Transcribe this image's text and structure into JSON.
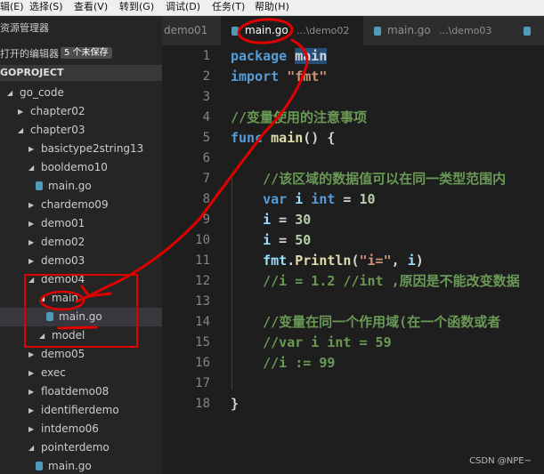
{
  "menubar": {
    "items": [
      "辑(E)",
      "选择(S)",
      "查看(V)",
      "转到(G)",
      "调试(D)",
      "任务(T)",
      "帮助(H)"
    ]
  },
  "sidebar": {
    "title": "资源管理器",
    "open_editors_label": "打开的编辑器",
    "unsaved_badge": "5 个未保存",
    "project": "GOPROJECT",
    "tree": [
      {
        "label": "go_code",
        "kind": "folder",
        "expanded": true
      },
      {
        "label": "chapter02",
        "kind": "folder",
        "expanded": false
      },
      {
        "label": "chapter03",
        "kind": "folder",
        "expanded": true
      },
      {
        "label": "basictype2string13",
        "kind": "folder",
        "expanded": false
      },
      {
        "label": "booldemo10",
        "kind": "folder",
        "expanded": true
      },
      {
        "label": "main.go",
        "kind": "file"
      },
      {
        "label": "chardemo09",
        "kind": "folder",
        "expanded": false
      },
      {
        "label": "demo01",
        "kind": "folder",
        "expanded": false
      },
      {
        "label": "demo02",
        "kind": "folder",
        "expanded": false
      },
      {
        "label": "demo03",
        "kind": "folder",
        "expanded": false
      },
      {
        "label": "demo04",
        "kind": "folder",
        "expanded": true
      },
      {
        "label": "main",
        "kind": "folder",
        "expanded": true
      },
      {
        "label": "main.go",
        "kind": "file",
        "selected": true
      },
      {
        "label": "model",
        "kind": "folder",
        "expanded": true
      },
      {
        "label": "demo05",
        "kind": "folder",
        "expanded": false
      },
      {
        "label": "exec",
        "kind": "folder",
        "expanded": false
      },
      {
        "label": "floatdemo08",
        "kind": "folder",
        "expanded": false
      },
      {
        "label": "identifierdemo",
        "kind": "folder",
        "expanded": false
      },
      {
        "label": "intdemo06",
        "kind": "folder",
        "expanded": false
      },
      {
        "label": "pointerdemo",
        "kind": "folder",
        "expanded": true
      },
      {
        "label": "main.go",
        "kind": "file"
      }
    ]
  },
  "tabs": [
    {
      "name": "demo01",
      "path": "",
      "active": false
    },
    {
      "name": "main.go",
      "path": "...\\demo02",
      "active": true
    },
    {
      "name": "main.go",
      "path": "...\\demo03",
      "active": false
    },
    {
      "name": "",
      "path": "",
      "active": false
    }
  ],
  "editor": {
    "line_numbers": [
      "1",
      "2",
      "3",
      "4",
      "5",
      "6",
      "7",
      "8",
      "9",
      "10",
      "11",
      "12",
      "13",
      "14",
      "15",
      "16",
      "17",
      "18"
    ],
    "lines": [
      [
        [
          "kw",
          "package"
        ],
        [
          "plain",
          " "
        ],
        [
          "hl",
          "main"
        ]
      ],
      [
        [
          "kw",
          "import"
        ],
        [
          "plain",
          " "
        ],
        [
          "str",
          "\"fmt\""
        ]
      ],
      [],
      [
        [
          "cm",
          "//变量使用的注意事项"
        ]
      ],
      [
        [
          "kw",
          "func"
        ],
        [
          "plain",
          " "
        ],
        [
          "fn",
          "main"
        ],
        [
          "plain",
          "() {"
        ]
      ],
      [],
      [
        [
          "cm",
          "    //该区域的数据值可以在同一类型范围内"
        ]
      ],
      [
        [
          "plain",
          "    "
        ],
        [
          "kw",
          "var"
        ],
        [
          "plain",
          " "
        ],
        [
          "var",
          "i"
        ],
        [
          "plain",
          " "
        ],
        [
          "kw",
          "int"
        ],
        [
          "plain",
          " = "
        ],
        [
          "num",
          "10"
        ]
      ],
      [
        [
          "plain",
          "    "
        ],
        [
          "var",
          "i"
        ],
        [
          "plain",
          " = "
        ],
        [
          "num",
          "30"
        ]
      ],
      [
        [
          "plain",
          "    "
        ],
        [
          "var",
          "i"
        ],
        [
          "plain",
          " = "
        ],
        [
          "num",
          "50"
        ]
      ],
      [
        [
          "plain",
          "    "
        ],
        [
          "var",
          "fmt"
        ],
        [
          "plain",
          "."
        ],
        [
          "fn",
          "Println"
        ],
        [
          "plain",
          "("
        ],
        [
          "str",
          "\"i=\""
        ],
        [
          "plain",
          ", "
        ],
        [
          "var",
          "i"
        ],
        [
          "plain",
          ")"
        ]
      ],
      [
        [
          "cm",
          "    //i = 1.2 //int ,原因是不能改变数据"
        ]
      ],
      [],
      [
        [
          "cm",
          "    //变量在同一个作用域(在一个函数或者"
        ]
      ],
      [
        [
          "cm",
          "    //var i int = 59"
        ]
      ],
      [
        [
          "cm",
          "    //i := 99"
        ]
      ],
      [],
      [
        [
          "plain",
          "}"
        ]
      ]
    ]
  },
  "watermark": "CSDN @NPE~",
  "colors": {
    "keyword": "#569cd6",
    "string": "#ce9178",
    "number": "#b5cea8",
    "comment": "#6a9955",
    "function": "#dcdcaa",
    "annotation": "#e00000"
  }
}
